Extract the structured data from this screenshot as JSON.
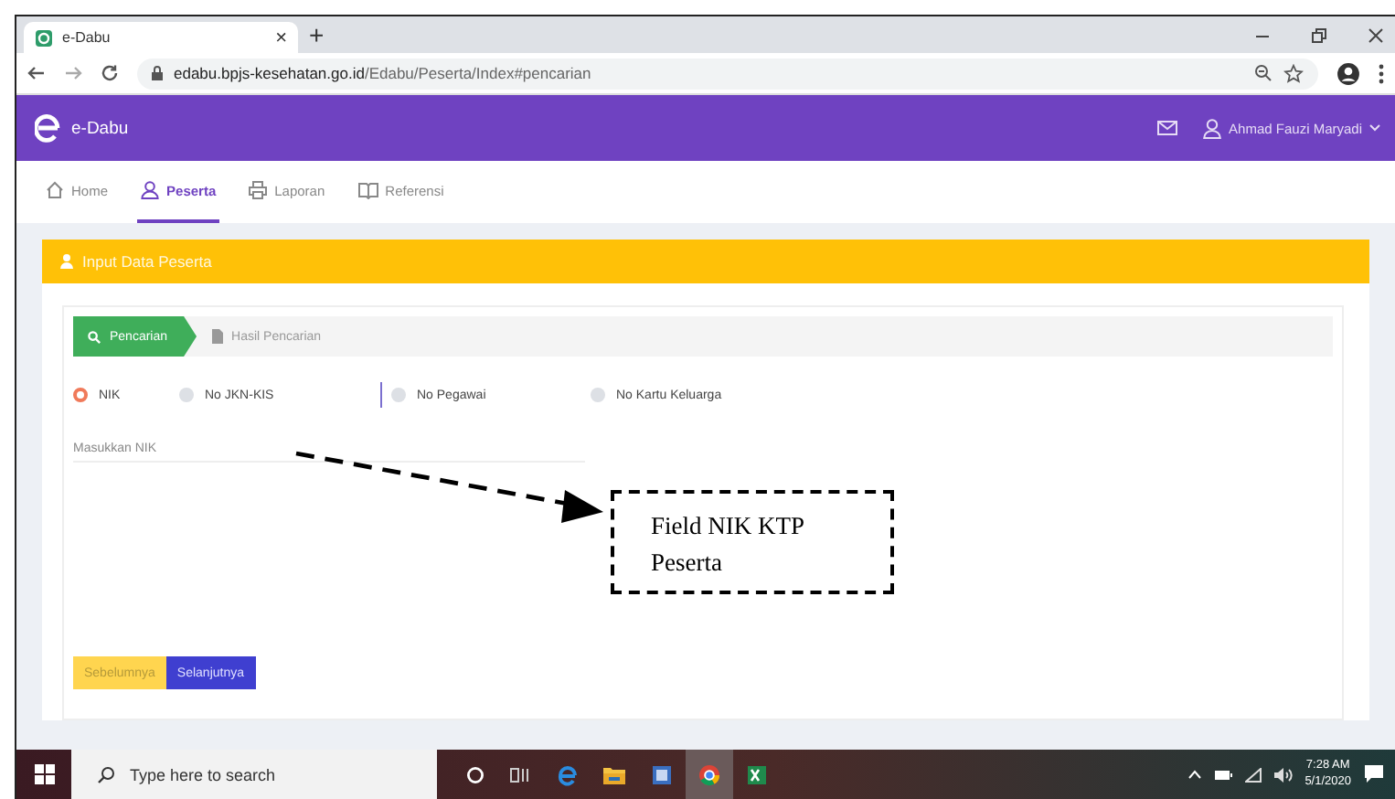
{
  "browser": {
    "tab_title": "e-Dabu",
    "tab_close": "×",
    "new_tab": "+",
    "url_host": "edabu.bpjs-kesehatan.go.id",
    "url_path": "/Edabu/Peserta/Index#pencarian"
  },
  "header": {
    "brand": "e-Dabu",
    "user": "Ahmad Fauzi Maryadi"
  },
  "nav": [
    {
      "label": "Home",
      "selected": false
    },
    {
      "label": "Peserta",
      "selected": true
    },
    {
      "label": "Laporan",
      "selected": false
    },
    {
      "label": "Referensi",
      "selected": false
    }
  ],
  "card": {
    "title": "Input Data Peserta"
  },
  "steps": [
    {
      "label": "Pencarian",
      "selected": true
    },
    {
      "label": "Hasil Pencarian",
      "selected": false
    }
  ],
  "options": [
    {
      "label": "NIK",
      "selected": true
    },
    {
      "label": "No JKN-KIS",
      "selected": false
    },
    {
      "label": "No Pegawai",
      "selected": false
    },
    {
      "label": "No Kartu Keluarga",
      "selected": false
    }
  ],
  "nik_field": {
    "placeholder": "Masukkan NIK"
  },
  "buttons": [
    {
      "label": "Sebelumnya",
      "kind": "secondary"
    },
    {
      "label": "Selanjutnya",
      "kind": "primary"
    }
  ],
  "annotation": {
    "lines": [
      "Field NIK KTP",
      "Peserta"
    ]
  },
  "taskbar": {
    "search_placeholder": "Type here to search",
    "time": "7:28 AM",
    "date": "5/1/2020"
  }
}
